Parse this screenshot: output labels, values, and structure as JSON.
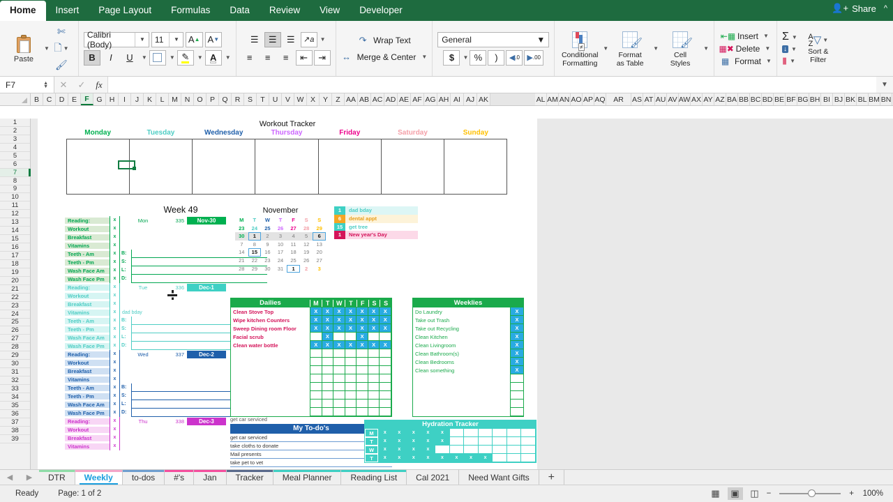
{
  "ribbon": {
    "tabs": [
      "Home",
      "Insert",
      "Page Layout",
      "Formulas",
      "Data",
      "Review",
      "View",
      "Developer"
    ],
    "active_tab": "Home",
    "share_label": "Share",
    "clipboard": {
      "paste_label": "Paste"
    },
    "font": {
      "name": "Calibri (Body)",
      "size": "11",
      "grow_label": "A",
      "shrink_label": "A",
      "bold": "B",
      "italic": "I",
      "underline": "U"
    },
    "alignment": {
      "wrap_text": "Wrap Text",
      "merge_center": "Merge & Center"
    },
    "number": {
      "format": "General",
      "currency": "$",
      "percent": "%",
      "comma": ")",
      "inc_dec": ".0",
      "dec_dec": ".00"
    },
    "styles": {
      "conditional": "Conditional\nFormatting",
      "conditional_l1": "Conditional",
      "conditional_l2": "Formatting",
      "format_table_l1": "Format",
      "format_table_l2": "as Table",
      "cell_styles_l1": "Cell",
      "cell_styles_l2": "Styles"
    },
    "cells": {
      "insert": "Insert",
      "delete": "Delete",
      "format": "Format"
    },
    "editing": {
      "sum": "Σ",
      "sort_filter_l1": "Sort &",
      "sort_filter_l2": "Filter"
    }
  },
  "formula_bar": {
    "name_box": "F7",
    "formula": "",
    "cancel_icon": "✕",
    "accept_icon": "✓",
    "fx": "fx"
  },
  "columns_left": [
    "B",
    "C",
    "D",
    "E",
    "F",
    "G",
    "H",
    "I",
    "J",
    "K",
    "L",
    "M",
    "N",
    "O",
    "P",
    "Q",
    "R",
    "S",
    "T",
    "U",
    "V",
    "W",
    "X",
    "Y",
    "Z",
    "AA",
    "AB",
    "AC",
    "AD",
    "AE",
    "AF",
    "AG",
    "AH",
    "AI",
    "AJ",
    "AK"
  ],
  "columns_right": [
    "AL",
    "AM",
    "AN",
    "AO",
    "AP",
    "AQ",
    "AR",
    "AS",
    "AT",
    "AU",
    "AV",
    "AW",
    "AX",
    "AY",
    "AZ",
    "BA",
    "BB",
    "BC",
    "BD",
    "BE",
    "BF",
    "BG",
    "BH",
    "BI",
    "BJ",
    "BK",
    "BL",
    "BM",
    "BN"
  ],
  "selected_column": "F",
  "rows": [
    1,
    2,
    3,
    4,
    5,
    6,
    7,
    8,
    9,
    10,
    11,
    12,
    13,
    14,
    15,
    16,
    17,
    18,
    19,
    20,
    21,
    22,
    23,
    24,
    25,
    26,
    27,
    28,
    29,
    30,
    31,
    32,
    33,
    34,
    35,
    36,
    37,
    38,
    39
  ],
  "selected_row": 7,
  "workout_tracker": {
    "title": "Workout Tracker",
    "days": [
      {
        "label": "Monday",
        "color": "#00b050"
      },
      {
        "label": "Tuesday",
        "color": "#4ecdc4"
      },
      {
        "label": "Wednesday",
        "color": "#1f5faa"
      },
      {
        "label": "Thursday",
        "color": "#cc66ff"
      },
      {
        "label": "Friday",
        "color": "#ec008c"
      },
      {
        "label": "Saturday",
        "color": "#f4a0a8"
      },
      {
        "label": "Sunday",
        "color": "#ffc000"
      }
    ]
  },
  "week_section": {
    "title": "Week 49",
    "days": [
      {
        "abbr": "Mon",
        "num": "335",
        "date": "Nov-30",
        "date_bg": "#00b050",
        "label_bg": "#d9ead3",
        "text_color": "#00a650",
        "note": "",
        "tasks": [
          "Reading:",
          "Workout",
          "Breakfast",
          "Vitamins",
          "Teeth - Am",
          "Teeth - Pm",
          "Wash Face Am",
          "Wash Face Pm"
        ],
        "meal_labels": [
          "B:",
          "S:",
          "L:",
          "D:"
        ]
      },
      {
        "abbr": "Tue",
        "num": "336",
        "date": "Dec-1",
        "date_bg": "#3ed0c4",
        "label_bg": "#d6f5f3",
        "text_color": "#4ecdc4",
        "note": "dad bday",
        "tasks": [
          "Reading:",
          "Workout",
          "Breakfast",
          "Vitamins",
          "Teeth - Am",
          "Teeth - Pm",
          "Wash Face Am",
          "Wash Face Pm"
        ],
        "meal_labels": [
          "B:",
          "S:",
          "L:",
          "D:"
        ]
      },
      {
        "abbr": "Wed",
        "num": "337",
        "date": "Dec-2",
        "date_bg": "#1f5faa",
        "label_bg": "#cfe0f3",
        "text_color": "#1f5faa",
        "note": "",
        "tasks": [
          "Reading:",
          "Workout",
          "Breakfast",
          "Vitamins",
          "Teeth - Am",
          "Teeth - Pm",
          "Wash Face Am",
          "Wash Face Pm"
        ],
        "meal_labels": [
          "B:",
          "S:",
          "L:",
          "D:"
        ]
      },
      {
        "abbr": "Thu",
        "num": "338",
        "date": "Dec-3",
        "date_bg": "#cc33cc",
        "label_bg": "#f8d6f5",
        "text_color": "#cc33cc",
        "note": "",
        "tasks": [
          "Reading:",
          "Workout",
          "Breakfast",
          "Vitamins"
        ],
        "meal_labels": []
      }
    ],
    "check_mark": "x"
  },
  "calendar": {
    "month": "November",
    "dow": [
      {
        "l": "M",
        "c": "#00b050"
      },
      {
        "l": "T",
        "c": "#4ecdc4"
      },
      {
        "l": "W",
        "c": "#1f5faa"
      },
      {
        "l": "T",
        "c": "#cc66ff"
      },
      {
        "l": "F",
        "c": "#ec008c"
      },
      {
        "l": "S",
        "c": "#f4a0a8"
      },
      {
        "l": "S",
        "c": "#ffc000"
      }
    ],
    "weeks": [
      [
        {
          "d": "23",
          "t": "prev"
        },
        {
          "d": "24",
          "t": "prev"
        },
        {
          "d": "25",
          "t": "prev"
        },
        {
          "d": "26",
          "t": "prev"
        },
        {
          "d": "27",
          "t": "prev"
        },
        {
          "d": "28",
          "t": "prev"
        },
        {
          "d": "29",
          "t": "prev"
        }
      ],
      [
        {
          "d": "30",
          "t": "prev-shade"
        },
        {
          "d": "1",
          "t": "mark-shade"
        },
        {
          "d": "2",
          "t": "cur-shade"
        },
        {
          "d": "3",
          "t": "cur-shade"
        },
        {
          "d": "4",
          "t": "cur-shade"
        },
        {
          "d": "5",
          "t": "cur-shade"
        },
        {
          "d": "6",
          "t": "mark-shade"
        }
      ],
      [
        {
          "d": "7",
          "t": "cur"
        },
        {
          "d": "8",
          "t": "cur"
        },
        {
          "d": "9",
          "t": "cur"
        },
        {
          "d": "10",
          "t": "cur"
        },
        {
          "d": "11",
          "t": "cur"
        },
        {
          "d": "12",
          "t": "cur"
        },
        {
          "d": "13",
          "t": "cur"
        }
      ],
      [
        {
          "d": "14",
          "t": "cur"
        },
        {
          "d": "15",
          "t": "mark"
        },
        {
          "d": "16",
          "t": "cur"
        },
        {
          "d": "17",
          "t": "cur"
        },
        {
          "d": "18",
          "t": "cur"
        },
        {
          "d": "19",
          "t": "cur"
        },
        {
          "d": "20",
          "t": "cur"
        }
      ],
      [
        {
          "d": "21",
          "t": "cur"
        },
        {
          "d": "22",
          "t": "cur"
        },
        {
          "d": "23",
          "t": "cur"
        },
        {
          "d": "24",
          "t": "cur"
        },
        {
          "d": "25",
          "t": "cur"
        },
        {
          "d": "26",
          "t": "cur"
        },
        {
          "d": "27",
          "t": "cur"
        }
      ],
      [
        {
          "d": "28",
          "t": "cur"
        },
        {
          "d": "29",
          "t": "cur"
        },
        {
          "d": "30",
          "t": "cur"
        },
        {
          "d": "31",
          "t": "cur"
        },
        {
          "d": "1",
          "t": "mark-next"
        },
        {
          "d": "2",
          "t": "next-sat"
        },
        {
          "d": "3",
          "t": "next-sun"
        }
      ]
    ]
  },
  "legend": [
    {
      "num": "1",
      "text": "dad bday",
      "num_bg": "#3ed0c4",
      "row_bg": "#ddf6f5",
      "text_color": "#4ecdc4"
    },
    {
      "num": "6",
      "text": "dental appt",
      "num_bg": "#f5a623",
      "row_bg": "#fdf3d9",
      "text_color": "#e8a01c"
    },
    {
      "num": "15",
      "text": "get tree",
      "num_bg": "#3ed0c4",
      "row_bg": "#ffffff",
      "text_color": "#4ecdc4"
    },
    {
      "num": "1",
      "text": "New year's Day",
      "num_bg": "#d4145a",
      "row_bg": "#fcd9e8",
      "text_color": "#d4145a"
    }
  ],
  "dailies": {
    "title": "Dailies",
    "day_headers": [
      "M",
      "T",
      "W",
      "T",
      "F",
      "S",
      "S"
    ],
    "rows": [
      {
        "name": "Clean Stove Top",
        "marks": [
          "x",
          "x",
          "x",
          "x",
          "x",
          "x",
          "x"
        ]
      },
      {
        "name": "Wipe kitchen Counters",
        "marks": [
          "x",
          "x",
          "x",
          "x",
          "x",
          "x",
          "x"
        ]
      },
      {
        "name": "Sweep Dining room Floor",
        "marks": [
          "x",
          "x",
          "x",
          "x",
          "x",
          "x",
          "x"
        ]
      },
      {
        "name": "Facial scrub",
        "marks": [
          "",
          "x",
          "",
          "",
          "x",
          "",
          ""
        ]
      },
      {
        "name": "Clean water bottle",
        "marks": [
          "x",
          "x",
          "x",
          "x",
          "x",
          "x",
          "x"
        ]
      },
      {
        "name": "",
        "marks": [
          "",
          "",
          "",
          "",
          "",
          "",
          ""
        ]
      },
      {
        "name": "",
        "marks": [
          "",
          "",
          "",
          "",
          "",
          "",
          ""
        ]
      },
      {
        "name": "",
        "marks": [
          "",
          "",
          "",
          "",
          "",
          "",
          ""
        ]
      },
      {
        "name": "",
        "marks": [
          "",
          "",
          "",
          "",
          "",
          "",
          ""
        ]
      },
      {
        "name": "",
        "marks": [
          "",
          "",
          "",
          "",
          "",
          "",
          ""
        ]
      },
      {
        "name": "",
        "marks": [
          "",
          "",
          "",
          "",
          "",
          "",
          ""
        ]
      },
      {
        "name": "",
        "marks": [
          "",
          "",
          "",
          "",
          "",
          "",
          ""
        ]
      },
      {
        "name": "",
        "marks": [
          "",
          "",
          "",
          "",
          "",
          "",
          ""
        ]
      }
    ]
  },
  "weeklies": {
    "title": "Weeklies",
    "rows": [
      {
        "name": "Do Laundry",
        "mark": "x"
      },
      {
        "name": "Take out Trash",
        "mark": "x"
      },
      {
        "name": "Take out Recycling",
        "mark": "x"
      },
      {
        "name": "Clean Kitchen",
        "mark": "x"
      },
      {
        "name": "Clean Livingroom",
        "mark": "x"
      },
      {
        "name": "Clean Bathroom(s)",
        "mark": "x"
      },
      {
        "name": "Clean Bedrooms",
        "mark": "x"
      },
      {
        "name": "Clean something",
        "mark": "x"
      },
      {
        "name": "",
        "mark": ""
      },
      {
        "name": "",
        "mark": ""
      },
      {
        "name": "",
        "mark": ""
      },
      {
        "name": "",
        "mark": ""
      },
      {
        "name": "",
        "mark": ""
      }
    ]
  },
  "todo": {
    "above_note": "get car serviced",
    "title": "My To-do's",
    "items": [
      "get car serviced",
      "take cloths to donate",
      "Mail presents",
      "take pet to vet"
    ]
  },
  "hydration": {
    "title": "Hydration Tracker",
    "rows": [
      {
        "day": "M",
        "marks": [
          "x",
          "x",
          "x",
          "x",
          "x",
          "",
          "",
          "",
          "",
          "",
          ""
        ]
      },
      {
        "day": "T",
        "marks": [
          "x",
          "x",
          "x",
          "x",
          "x",
          "",
          "",
          "",
          "",
          "",
          ""
        ]
      },
      {
        "day": "W",
        "marks": [
          "x",
          "x",
          "x",
          "x",
          "",
          "",
          "",
          "",
          "",
          "",
          ""
        ]
      },
      {
        "day": "T",
        "marks": [
          "x",
          "x",
          "x",
          "x",
          "x",
          "x",
          "x",
          "x",
          "",
          "",
          ""
        ]
      }
    ]
  },
  "sheet_tabs": [
    {
      "label": "DTR",
      "color": "#8fdda8",
      "active": false
    },
    {
      "label": "Weekly",
      "color": "#f5a6c8",
      "active": true
    },
    {
      "label": "to-dos",
      "color": "#6f9fd0",
      "active": false
    },
    {
      "label": "#'s",
      "color": "#f54e9e",
      "active": false
    },
    {
      "label": "Jan",
      "color": "#f54e9e",
      "active": false
    },
    {
      "label": "Tracker",
      "color": "#5a6a8c",
      "active": false
    },
    {
      "label": "Meal Planner",
      "color": "#3ed0c4",
      "active": false
    },
    {
      "label": "Reading List",
      "color": "#3ed0c4",
      "active": false
    },
    {
      "label": "Cal 2021",
      "color": "#efefef",
      "active": false
    },
    {
      "label": "Need Want Gifts",
      "color": "#efefef",
      "active": false
    }
  ],
  "add_sheet_label": "+",
  "status_bar": {
    "ready": "Ready",
    "page": "Page: 1 of 2",
    "zoom": "100%",
    "zoom_out": "−",
    "zoom_in": "+"
  }
}
